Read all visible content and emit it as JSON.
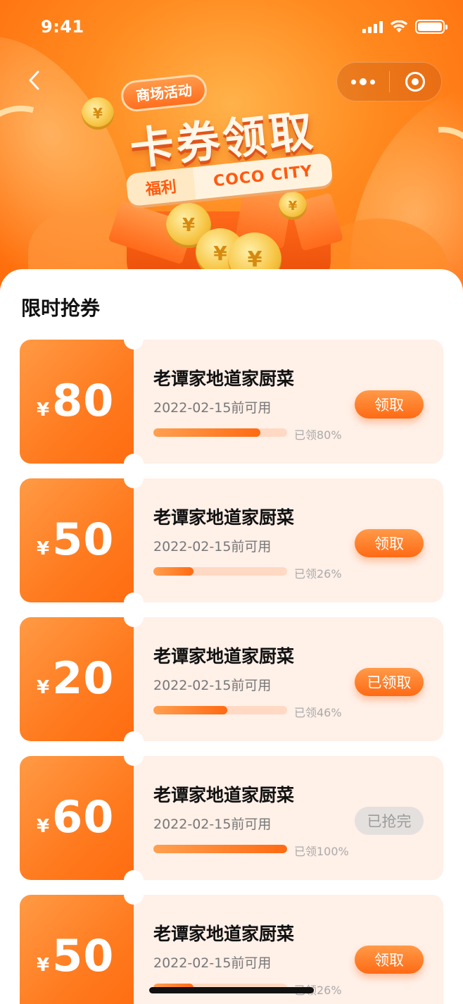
{
  "status_bar": {
    "time": "9:41"
  },
  "hero": {
    "tag": "商场活动",
    "title": "卡券领取",
    "ribbon_left": "福利",
    "ribbon_right": "COCO CITY",
    "coin_symbol": "¥"
  },
  "section": {
    "title": "限时抢券"
  },
  "coupons": [
    {
      "currency": "¥",
      "amount": "80",
      "shop": "老谭家地道家厨菜",
      "date": "2022-02-15前可用",
      "progress": 0.8,
      "progress_text": "已领80%",
      "button": "领取",
      "state": "available"
    },
    {
      "currency": "¥",
      "amount": "50",
      "shop": "老谭家地道家厨菜",
      "date": "2022-02-15前可用",
      "progress": 0.3,
      "progress_text": "已领26%",
      "button": "领取",
      "state": "available"
    },
    {
      "currency": "¥",
      "amount": "20",
      "shop": "老谭家地道家厨菜",
      "date": "2022-02-15前可用",
      "progress": 0.55,
      "progress_text": "已领46%",
      "button": "已领取",
      "state": "claimed"
    },
    {
      "currency": "¥",
      "amount": "60",
      "shop": "老谭家地道家厨菜",
      "date": "2022-02-15前可用",
      "progress": 1.0,
      "progress_text": "已领100%",
      "button": "已抢完",
      "state": "sold_out"
    },
    {
      "currency": "¥",
      "amount": "50",
      "shop": "老谭家地道家厨菜",
      "date": "2022-02-15前可用",
      "progress": 0.3,
      "progress_text": "已领26%",
      "button": "领取",
      "state": "available"
    }
  ],
  "colors": {
    "accent": "#ff6a14",
    "coupon_bg": "#fff0e8",
    "disabled_btn": "#e4e0de"
  }
}
